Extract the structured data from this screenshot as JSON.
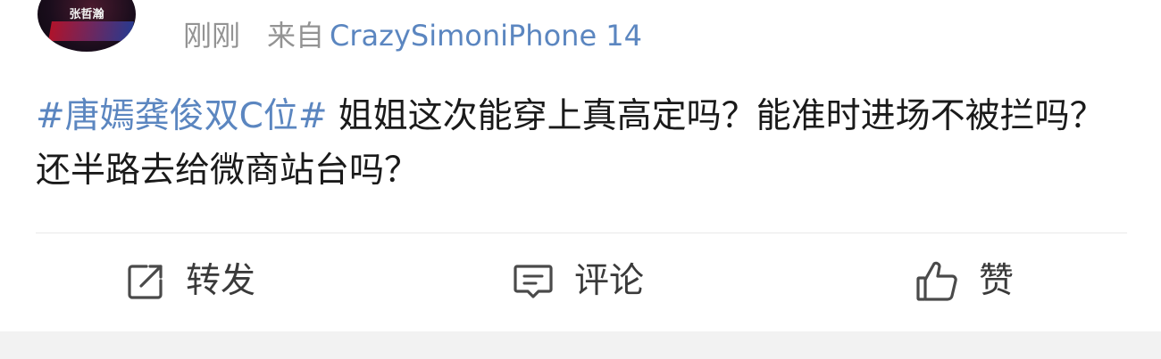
{
  "post": {
    "avatar_name": "张哲瀚",
    "time": "刚刚",
    "source_prefix": "来自",
    "source": "CrazySimoniPhone 14",
    "topic": "#唐嫣龚俊双C位#",
    "text": "姐姐这次能穿上真高定吗？能准时进场不被拦吗？还半路去给微商站台吗？"
  },
  "actions": {
    "repost_label": "转发",
    "comment_label": "评论",
    "like_label": "赞"
  },
  "icons": {
    "repost": "share-square-icon",
    "comment": "comment-bubble-icon",
    "like": "thumbs-up-icon"
  },
  "colors": {
    "link": "#5b86c0",
    "meta": "#939393",
    "text": "#1a1a1a",
    "divider": "#e9e9e9",
    "footer_bg": "#f2f2f2"
  }
}
